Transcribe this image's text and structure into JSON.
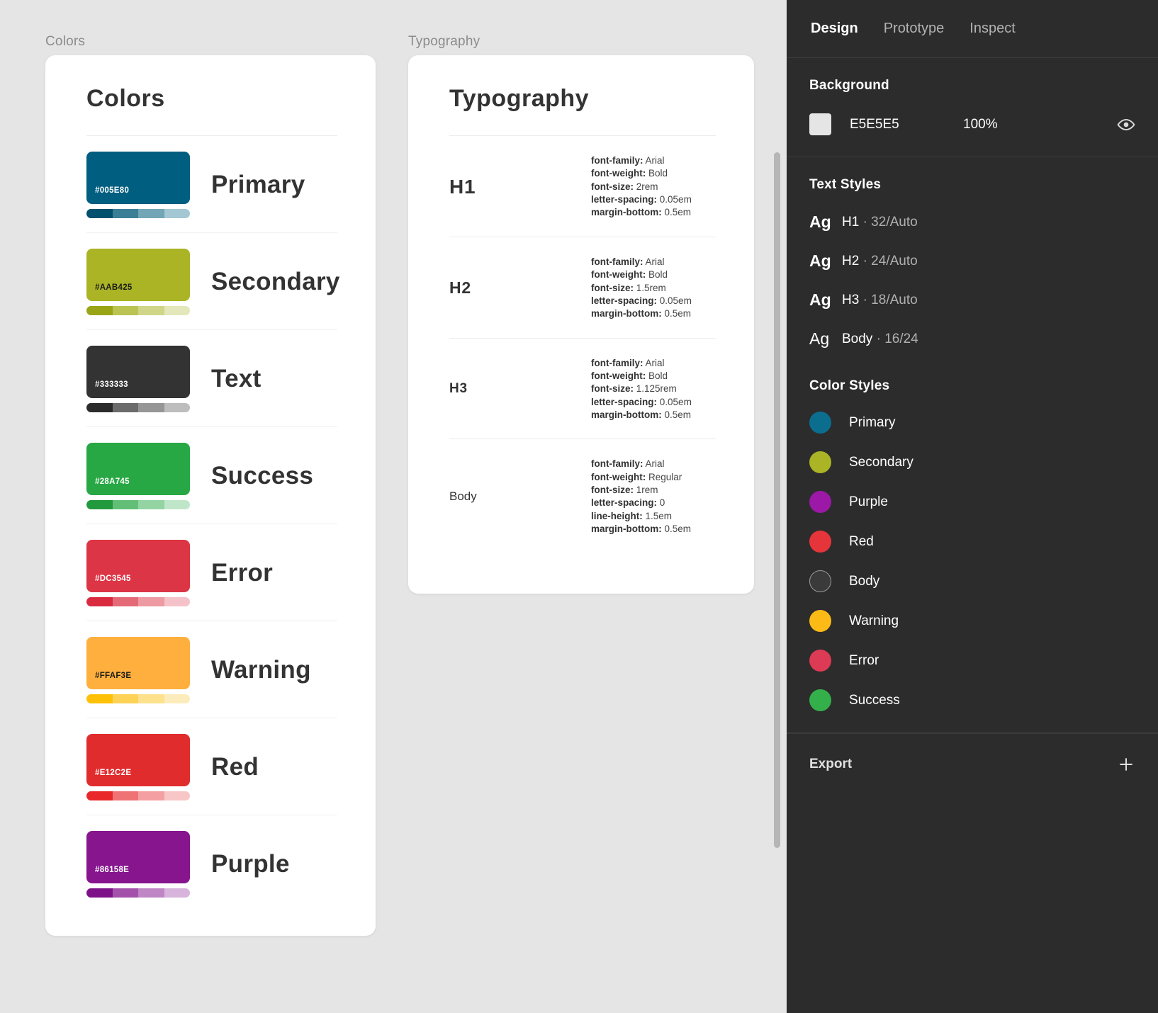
{
  "canvas": {
    "frames": [
      {
        "label": "Colors"
      },
      {
        "label": "Typography"
      }
    ],
    "colors_card": {
      "title": "Colors",
      "swatches": [
        {
          "name": "Primary",
          "hex": "#005E80",
          "hex_text_color": "#ffffff",
          "tints": [
            "#00506e",
            "#3b7f96",
            "#72a6b6",
            "#a3c7d3"
          ]
        },
        {
          "name": "Secondary",
          "hex": "#AAB425",
          "hex_text_color": "#1a1a1a",
          "tints": [
            "#9aa516",
            "#bbc452",
            "#d0d687",
            "#e3e7b9"
          ]
        },
        {
          "name": "Text",
          "hex": "#333333",
          "hex_text_color": "#ffffff",
          "tints": [
            "#2b2b2b",
            "#6b6b6b",
            "#969696",
            "#bdbdbd"
          ]
        },
        {
          "name": "Success",
          "hex": "#28A745",
          "hex_text_color": "#ffffff",
          "tints": [
            "#23993d",
            "#63bf78",
            "#93d4a2",
            "#bfe6c8"
          ]
        },
        {
          "name": "Error",
          "hex": "#DC3545",
          "hex_text_color": "#ffffff",
          "tints": [
            "#d92a40",
            "#e46a77",
            "#ed9aa3",
            "#f4c2c8"
          ]
        },
        {
          "name": "Warning",
          "hex": "#FFAF3E",
          "hex_text_color": "#1a1a1a",
          "tints": [
            "#ffc107",
            "#fdd256",
            "#fde18d",
            "#fdecbb"
          ]
        },
        {
          "name": "Red",
          "hex": "#E12C2E",
          "hex_text_color": "#ffffff",
          "tints": [
            "#e9282a",
            "#ef7275",
            "#f4a0a2",
            "#f8c6c7"
          ]
        },
        {
          "name": "Purple",
          "hex": "#86158E",
          "hex_text_color": "#ffffff",
          "tints": [
            "#7d1188",
            "#a451ab",
            "#bf85c4",
            "#d8b3db"
          ]
        }
      ]
    },
    "typography_card": {
      "title": "Typography",
      "rows": [
        {
          "name": "H1",
          "size_class": "h1",
          "specs": [
            {
              "prop": "font-family:",
              "value": "Arial"
            },
            {
              "prop": "font-weight:",
              "value": "Bold"
            },
            {
              "prop": "font-size:",
              "value": "2rem"
            },
            {
              "prop": "letter-spacing:",
              "value": "0.05em"
            },
            {
              "prop": "margin-bottom:",
              "value": "0.5em"
            }
          ]
        },
        {
          "name": "H2",
          "size_class": "h2",
          "specs": [
            {
              "prop": "font-family:",
              "value": "Arial"
            },
            {
              "prop": "font-weight:",
              "value": "Bold"
            },
            {
              "prop": "font-size:",
              "value": "1.5rem"
            },
            {
              "prop": "letter-spacing:",
              "value": "0.05em"
            },
            {
              "prop": "margin-bottom:",
              "value": "0.5em"
            }
          ]
        },
        {
          "name": "H3",
          "size_class": "h3",
          "specs": [
            {
              "prop": "font-family:",
              "value": "Arial"
            },
            {
              "prop": "font-weight:",
              "value": "Bold"
            },
            {
              "prop": "font-size:",
              "value": "1.125rem"
            },
            {
              "prop": "letter-spacing:",
              "value": "0.05em"
            },
            {
              "prop": "margin-bottom:",
              "value": "0.5em"
            }
          ]
        },
        {
          "name": "Body",
          "size_class": "body",
          "specs": [
            {
              "prop": "font-family:",
              "value": "Arial"
            },
            {
              "prop": "font-weight:",
              "value": "Regular"
            },
            {
              "prop": "font-size:",
              "value": "1rem"
            },
            {
              "prop": "letter-spacing:",
              "value": "0"
            },
            {
              "prop": "line-height:",
              "value": "1.5em"
            },
            {
              "prop": "margin-bottom:",
              "value": "0.5em"
            }
          ]
        }
      ]
    }
  },
  "panel": {
    "tabs": [
      {
        "label": "Design",
        "active": true
      },
      {
        "label": "Prototype",
        "active": false
      },
      {
        "label": "Inspect",
        "active": false
      }
    ],
    "background": {
      "title": "Background",
      "swatch_color": "#E5E5E5",
      "hex": "E5E5E5",
      "opacity": "100%",
      "visibility_icon": "eye-icon"
    },
    "text_styles": {
      "title": "Text Styles",
      "items": [
        {
          "preview": "Ag",
          "bold": true,
          "name": "H1",
          "meta": " · 32/Auto"
        },
        {
          "preview": "Ag",
          "bold": true,
          "name": "H2",
          "meta": " · 24/Auto"
        },
        {
          "preview": "Ag",
          "bold": true,
          "name": "H3",
          "meta": " · 18/Auto"
        },
        {
          "preview": "Ag",
          "bold": false,
          "name": "Body",
          "meta": " · 16/24"
        }
      ]
    },
    "color_styles": {
      "title": "Color Styles",
      "items": [
        {
          "name": "Primary",
          "color": "#0B6E8F",
          "hollow": false
        },
        {
          "name": "Secondary",
          "color": "#AAB425",
          "hollow": false
        },
        {
          "name": "Purple",
          "color": "#9B19A6",
          "hollow": false
        },
        {
          "name": "Red",
          "color": "#E6353A",
          "hollow": false
        },
        {
          "name": "Body",
          "color": "#3a3a3a",
          "hollow": true
        },
        {
          "name": "Warning",
          "color": "#FCBA16",
          "hollow": false
        },
        {
          "name": "Error",
          "color": "#DC3A55",
          "hollow": false
        },
        {
          "name": "Success",
          "color": "#34B04A",
          "hollow": false
        }
      ]
    },
    "export": {
      "title": "Export",
      "add_icon": "plus-icon"
    }
  }
}
